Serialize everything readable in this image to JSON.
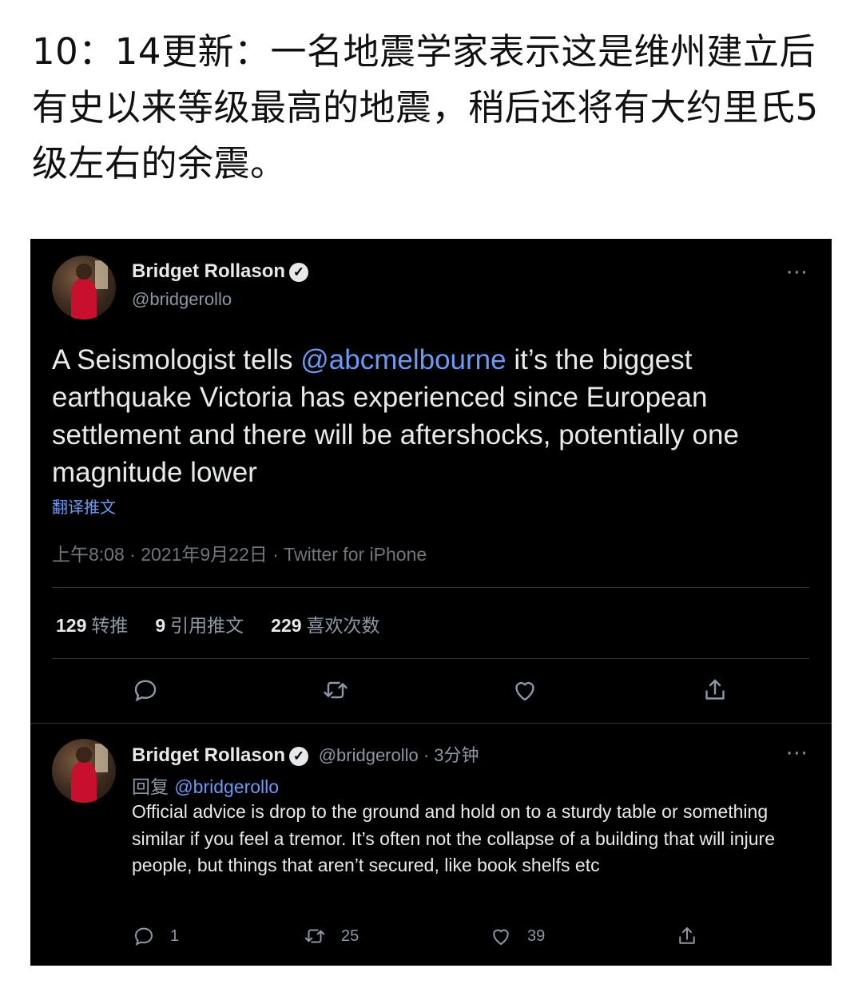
{
  "headline": "10：14更新：一名地震学家表示这是维州建立后有史以来等级最高的地震，稍后还将有大约里氏5级左右的余震。",
  "main_tweet": {
    "author_name": "Bridget Rollason",
    "handle": "@bridgerollo",
    "text_before": "A Seismologist tells ",
    "mention": "@abcmelbourne",
    "text_after": " it’s the biggest earthquake Victoria has experienced since European settlement and there will be aftershocks, potentially one magnitude lower",
    "translate_label": "翻译推文",
    "meta": "上午8:08 · 2021年9月22日 · Twitter for iPhone",
    "retweets_count": "129",
    "retweets_label": "转推",
    "quotes_count": "9",
    "quotes_label": "引用推文",
    "likes_count": "229",
    "likes_label": "喜欢次数"
  },
  "reply_tweet": {
    "author_name": "Bridget Rollason",
    "handle_time": "@bridgerollo · 3分钟",
    "reply_prefix": "回复",
    "reply_mention": "@bridgerollo",
    "text": "Official advice is drop to the ground and hold on to a sturdy table or something similar if you feel a tremor. It’s often not the collapse of a building that will injure people, but things that aren’t secured, like book shelfs etc",
    "reply_count": "1",
    "retweet_count": "25",
    "like_count": "39"
  },
  "icons": [
    "verified-badge-icon",
    "more-icon",
    "reply-icon",
    "retweet-icon",
    "like-icon",
    "share-icon"
  ]
}
